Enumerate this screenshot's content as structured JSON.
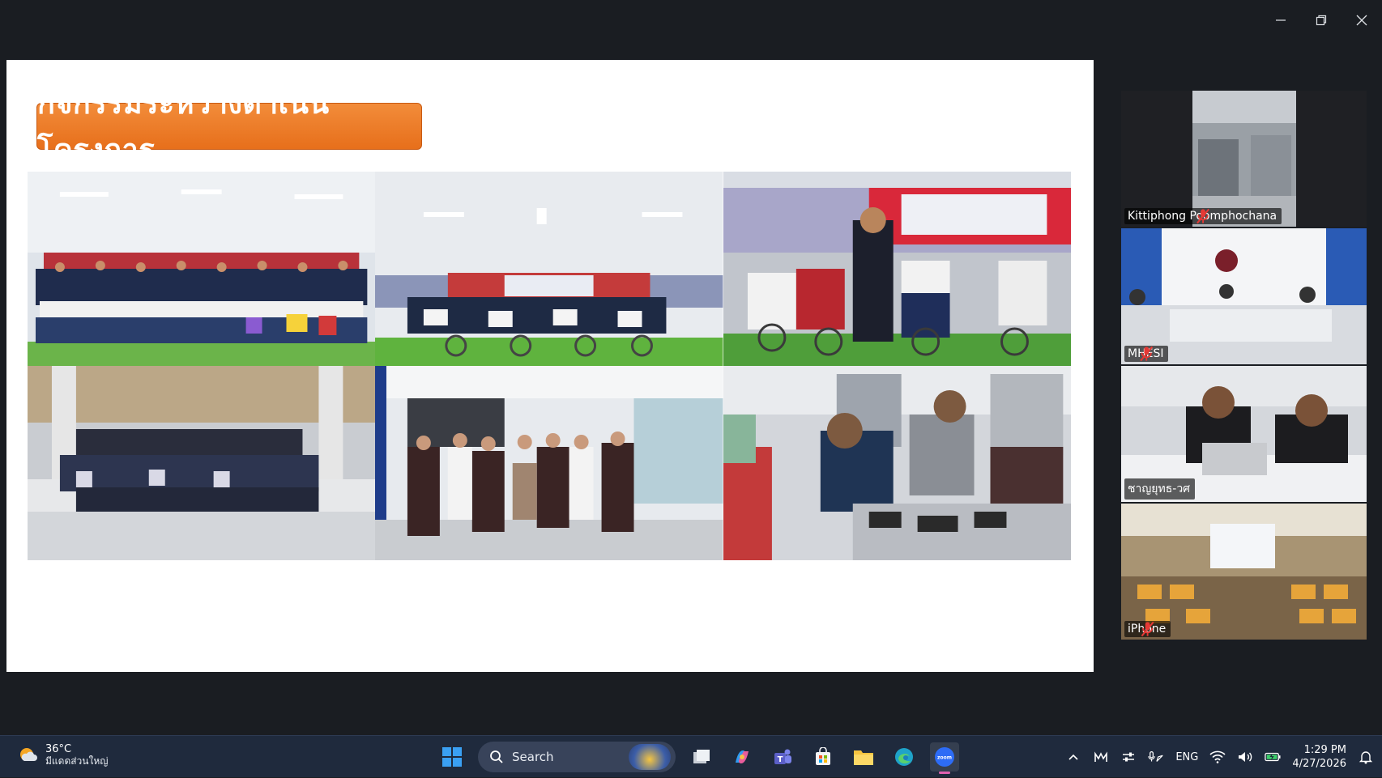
{
  "slide": {
    "title": "กิจกรรมระหว่างดำเนินโครงการ"
  },
  "participants": [
    {
      "name": "Kittiphong Poomphochana",
      "muted": true,
      "active": false
    },
    {
      "name": "MHESI",
      "muted": true,
      "active": false
    },
    {
      "name": "ชาญยุทธ-วศ",
      "muted": false,
      "active": true
    },
    {
      "name": "iPhone",
      "muted": true,
      "active": false
    }
  ],
  "taskbar": {
    "weather": {
      "temp": "36°C",
      "desc": "มีแดดส่วนใหญ่"
    },
    "search_placeholder": "Search",
    "language": "ENG",
    "time": "1:29 PM",
    "date": "4/27/2026"
  },
  "colors": {
    "title_bg": "#ea7a28",
    "active_speaker": "#2ecc71",
    "taskbar": "#1f2a3d"
  }
}
